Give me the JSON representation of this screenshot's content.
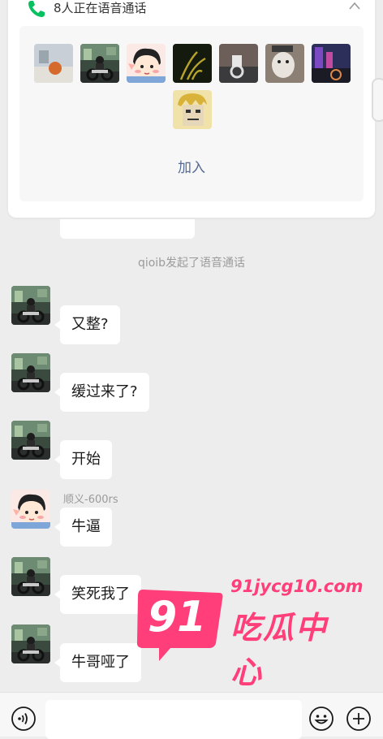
{
  "voice_call": {
    "title": "8人正在语音通话",
    "join_label": "加入",
    "participants": [
      "street-scene-avatar",
      "motorcycle-rider-avatar",
      "cartoon-boy-avatar",
      "dark-plant-avatar",
      "motorcycle-night-avatar",
      "cat-with-sign-avatar",
      "purple-street-avatar",
      "cartoon-face-avatar"
    ]
  },
  "chat": {
    "system_message": "qioib发起了语音通话",
    "messages": [
      {
        "avatar": "motorcycle-rider-avatar",
        "text": "又整?"
      },
      {
        "avatar": "motorcycle-rider-avatar",
        "text": "缓过来了?"
      },
      {
        "avatar": "motorcycle-rider-avatar",
        "text": "开始"
      },
      {
        "avatar": "cartoon-boy-avatar",
        "sender": "顺义-600rs",
        "text": "牛逼"
      },
      {
        "avatar": "motorcycle-rider-avatar",
        "text": "笑死我了"
      },
      {
        "avatar": "motorcycle-rider-avatar",
        "text": "牛哥哑了"
      }
    ]
  },
  "watermark": {
    "number": "91",
    "url": "91jycg10.com",
    "name": "吃瓜中心",
    "color": "#ff3e7a"
  },
  "input_bar": {
    "icons": [
      "voice-icon",
      "emoji-icon",
      "plus-icon"
    ]
  },
  "colors": {
    "background": "#ededed",
    "link": "#576b95",
    "call_green": "#07c160"
  }
}
